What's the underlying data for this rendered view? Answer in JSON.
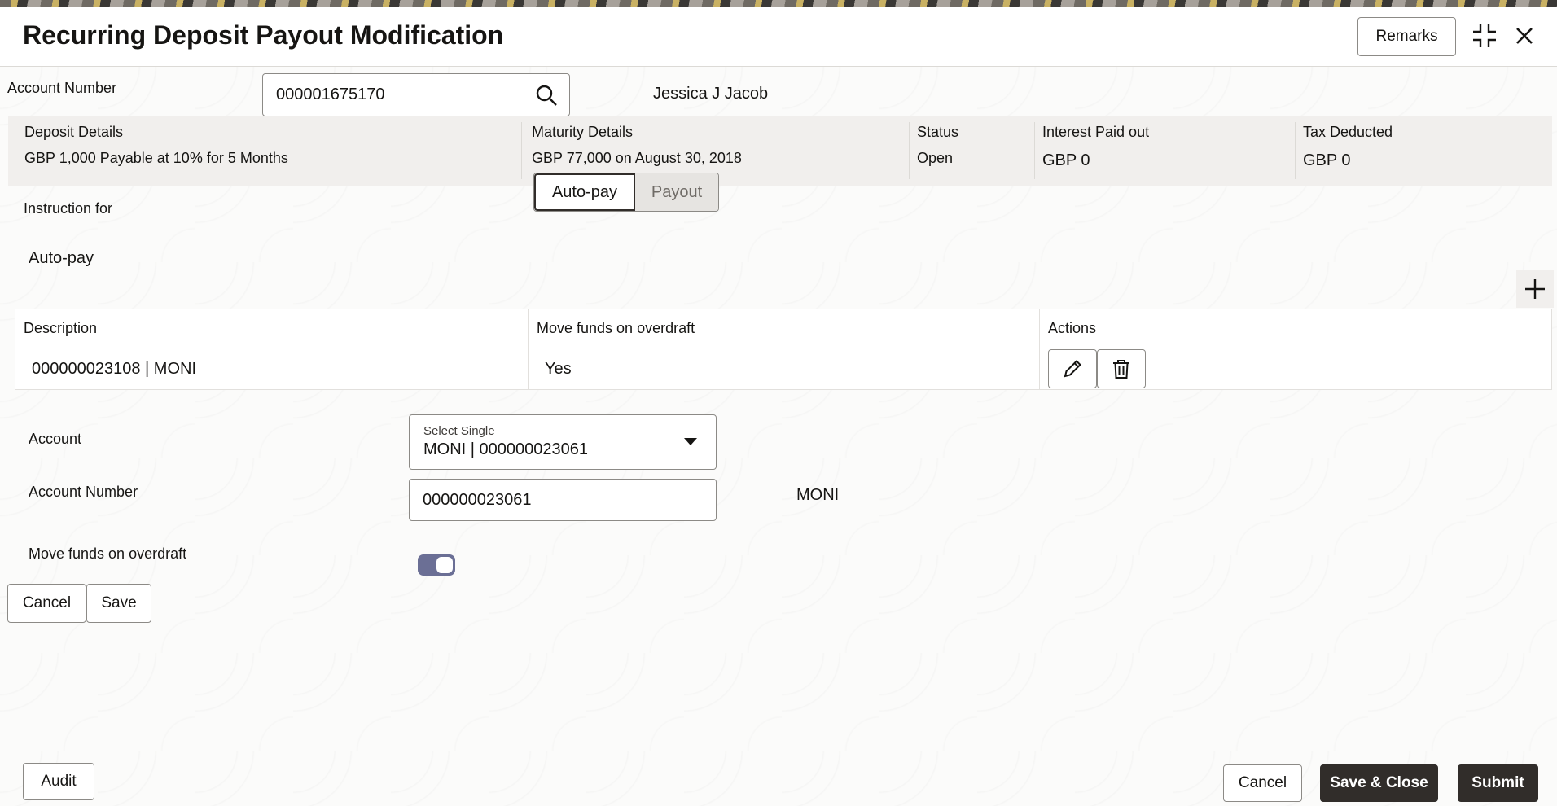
{
  "header": {
    "title": "Recurring Deposit Payout Modification",
    "remarks_label": "Remarks",
    "icons": [
      "minimize-icon",
      "close-icon"
    ]
  },
  "account": {
    "label": "Account Number",
    "value": "000001675170",
    "holder_name": "Jessica J Jacob"
  },
  "details": {
    "deposit": {
      "label": "Deposit Details",
      "value": "GBP 1,000 Payable at 10% for 5 Months"
    },
    "maturity": {
      "label": "Maturity Details",
      "value": "GBP 77,000 on August 30, 2018"
    },
    "status": {
      "label": "Status",
      "value": "Open"
    },
    "interest": {
      "label": "Interest Paid out",
      "value": "GBP 0"
    },
    "tax": {
      "label": "Tax Deducted",
      "value": "GBP 0"
    }
  },
  "instruction": {
    "label": "Instruction for",
    "options": [
      "Auto-pay",
      "Payout"
    ],
    "selected": "Auto-pay",
    "section_title": "Auto-pay"
  },
  "table": {
    "headers": [
      "Description",
      "Move funds on overdraft",
      "Actions"
    ],
    "rows": [
      {
        "description": "000000023108 | MONI",
        "move_funds": "Yes"
      }
    ]
  },
  "form": {
    "account_label": "Account",
    "account_select_hint": "Select Single",
    "account_select_value": "MONI | 000000023061",
    "account_number_label": "Account Number",
    "account_number_value": "000000023061",
    "account_name": "MONI",
    "move_funds_label": "Move funds on overdraft",
    "move_funds_on": true,
    "cancel_label": "Cancel",
    "save_label": "Save"
  },
  "footer": {
    "audit_label": "Audit",
    "cancel_label": "Cancel",
    "save_close_label": "Save & Close",
    "submit_label": "Submit"
  },
  "colors": {
    "primary_dark": "#312d2a",
    "toggle_on": "#6b6f95",
    "panel_bg": "#f1efed"
  }
}
